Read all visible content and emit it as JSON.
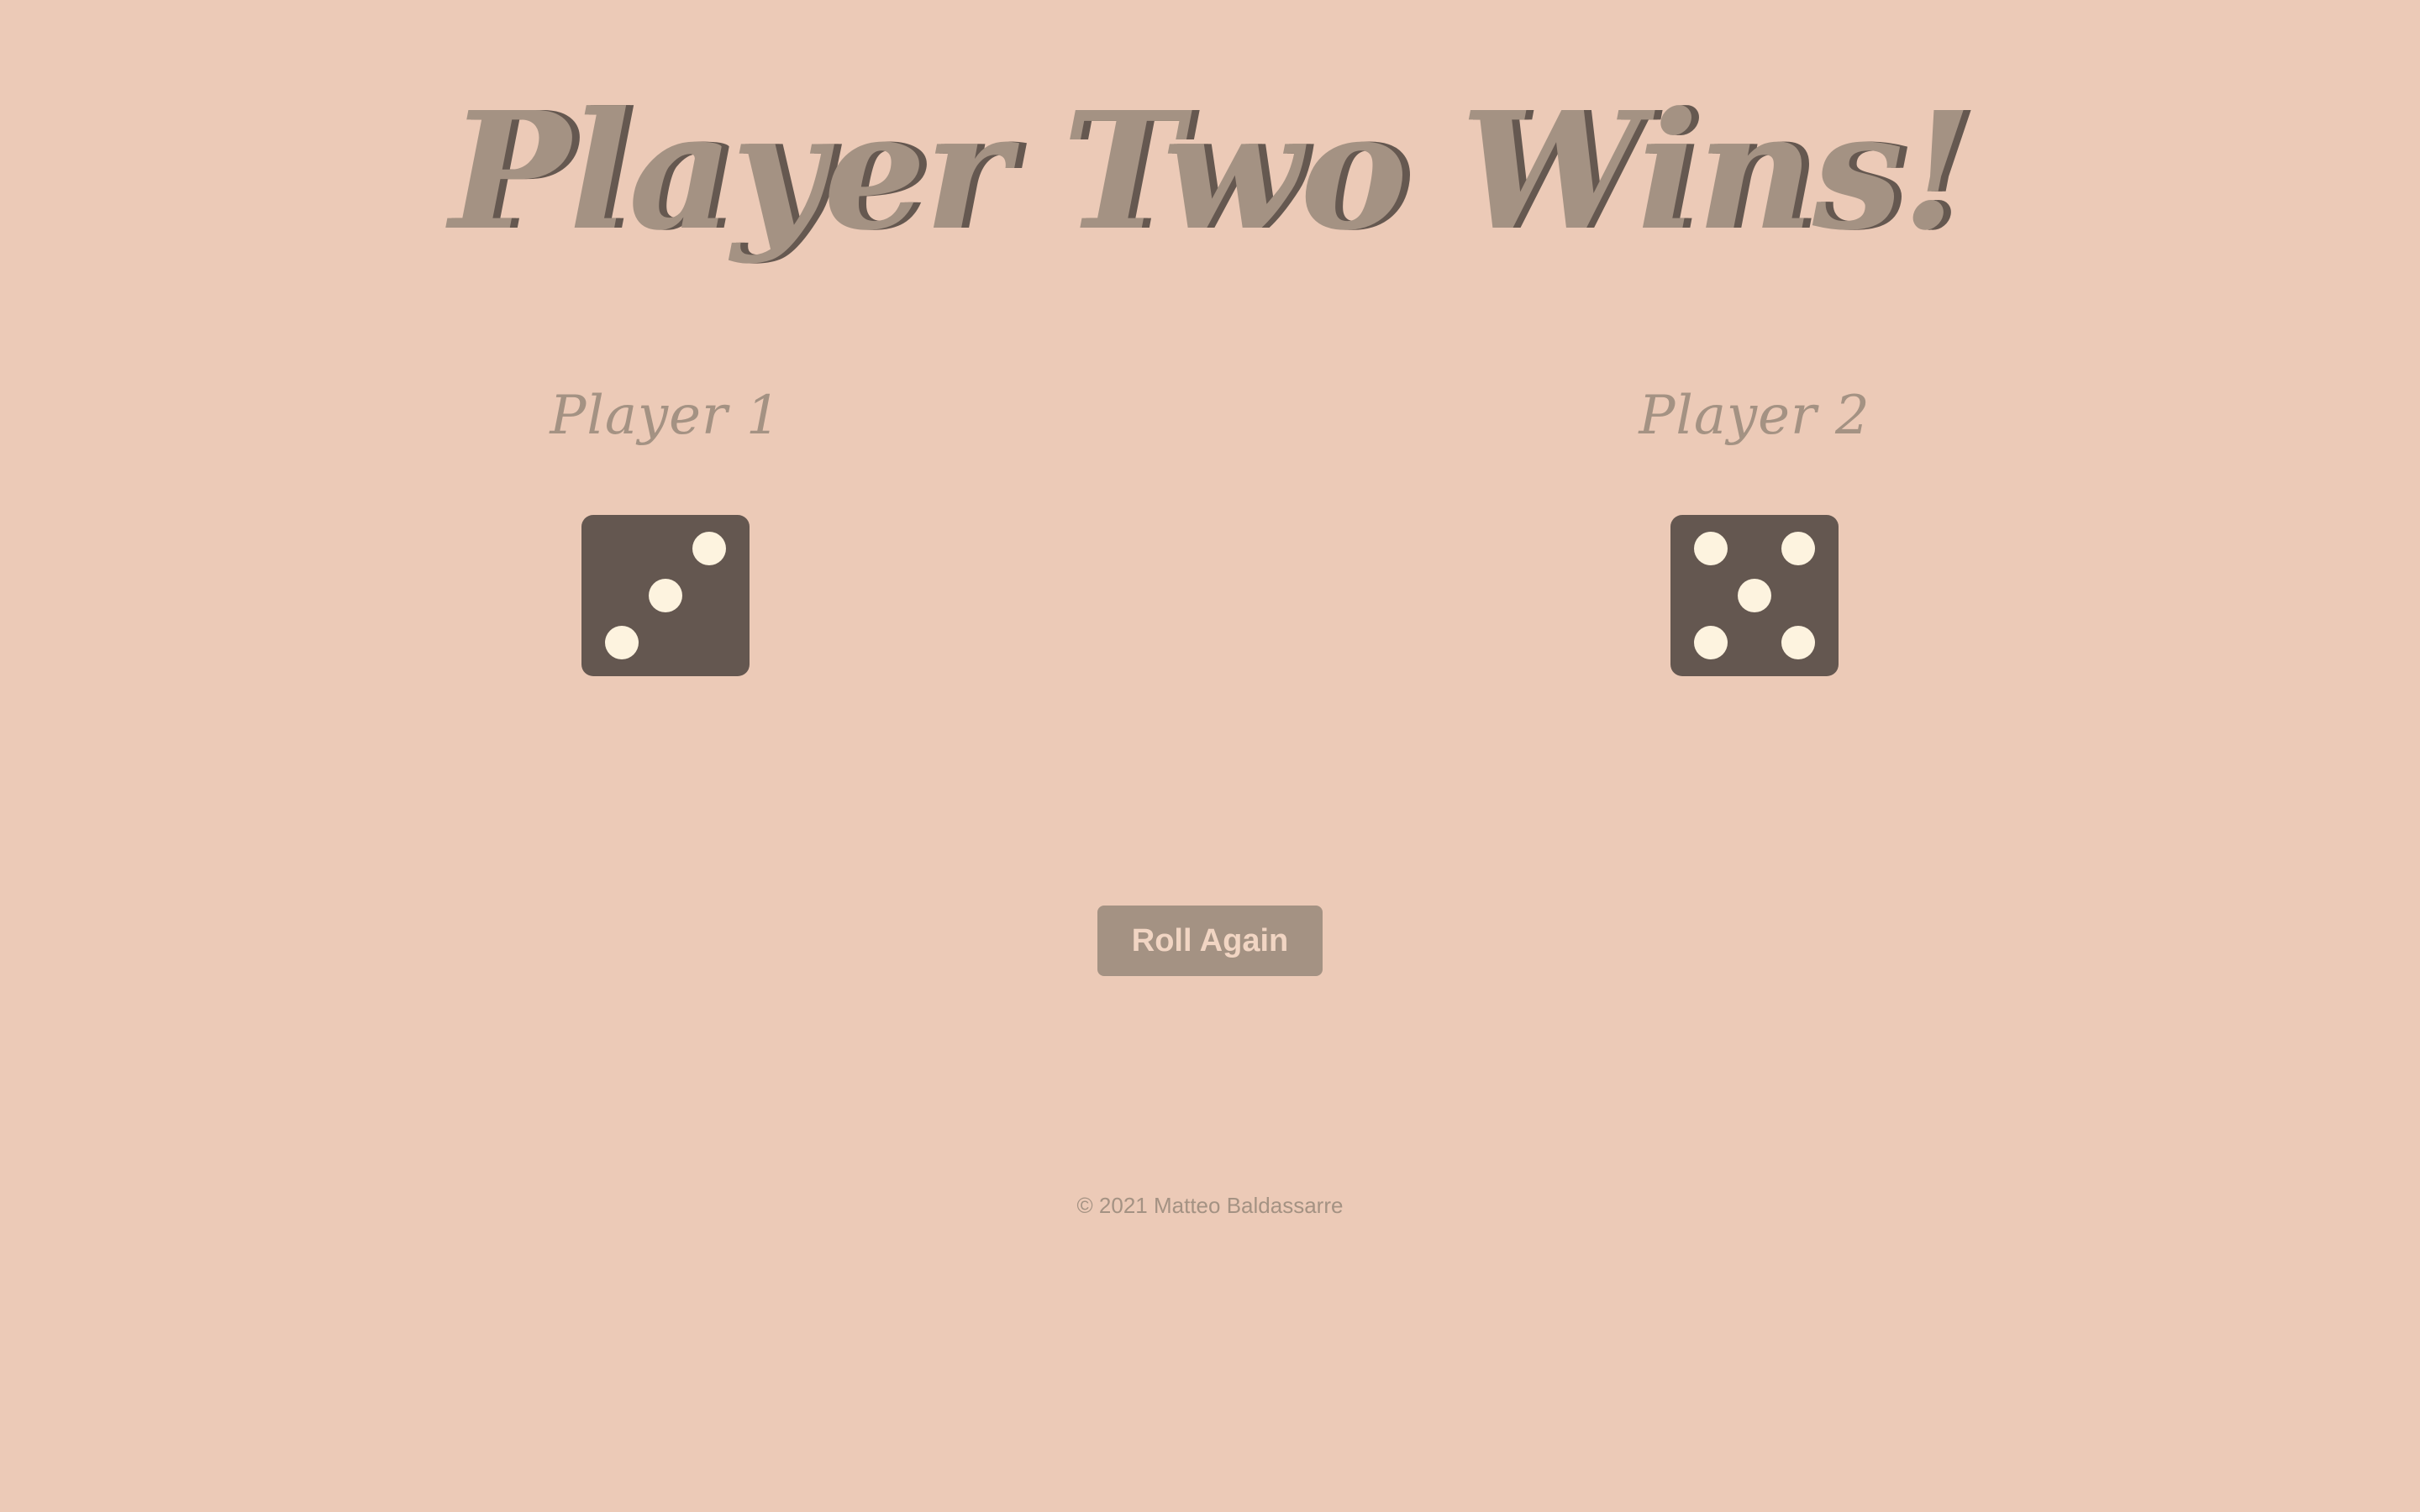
{
  "header": {
    "title": "Player Two Wins!"
  },
  "players": [
    {
      "label": "Player 1",
      "die_value": 3
    },
    {
      "label": "Player 2",
      "die_value": 5
    }
  ],
  "actions": {
    "roll_label": "Roll Again"
  },
  "footer": {
    "copyright": "© 2021 Matteo Baldassarre"
  },
  "colors": {
    "background": "#ECCAB7",
    "title": "#A49283",
    "title_shadow": "#655850",
    "die_face": "#645750",
    "pip": "#FDF3DF",
    "button_bg": "#A49283",
    "button_text": "#F1D5C3"
  }
}
